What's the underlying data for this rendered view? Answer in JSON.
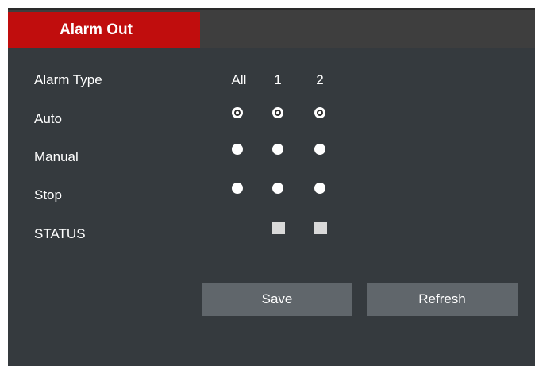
{
  "tab": {
    "title": "Alarm Out"
  },
  "table": {
    "header_label": "Alarm Type",
    "columns": [
      "All",
      "1",
      "2"
    ],
    "rows": [
      {
        "label": "Auto",
        "selected": [
          true,
          true,
          true
        ]
      },
      {
        "label": "Manual",
        "selected": [
          false,
          false,
          false
        ]
      },
      {
        "label": "Stop",
        "selected": [
          false,
          false,
          false
        ]
      }
    ],
    "status": {
      "label": "STATUS"
    }
  },
  "buttons": {
    "save": "Save",
    "refresh": "Refresh"
  },
  "colors": {
    "accent": "#c00d0d",
    "panel": "#353a3e",
    "button": "#60666b"
  }
}
